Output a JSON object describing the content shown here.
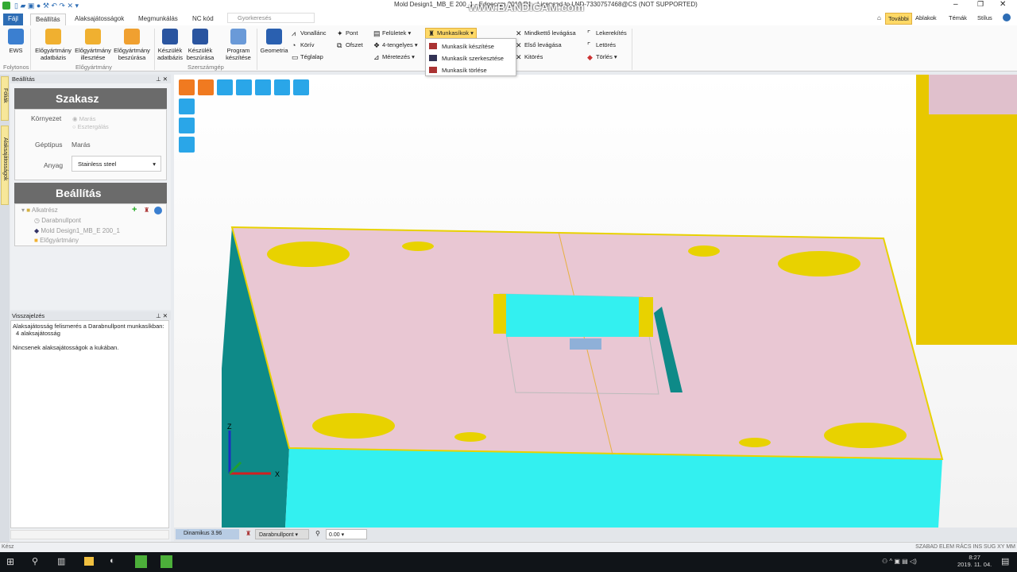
{
  "window": {
    "title": "Mold Design1_MB_E 200_1 - Edgecam 2019 R1 - Licensed to LND-7330757468@CS (NOT SUPPORTED)",
    "watermark": "www.BANDICAM.com"
  },
  "tabs": [
    {
      "label": "Fájl"
    },
    {
      "label": "Beállítás"
    },
    {
      "label": "Alaksajátosságok"
    },
    {
      "label": "Megmunkálás"
    },
    {
      "label": "NC kód"
    }
  ],
  "search_placeholder": "Gyorkeresés",
  "top_right": {
    "tovabbi": "További",
    "ablakok": "Ablakok",
    "temak": "Témák",
    "stilus": "Stílus"
  },
  "ribbon": {
    "ews": "EWS",
    "group_folytonos": "Folytonos",
    "elo_adatbazis": "Előgyártmány adatbázis",
    "elo_illesztese": "Előgyártmány illesztése",
    "elo_beszurasa": "Előgyártmány beszúrása",
    "group_elogyartmany": "Előgyártmány",
    "kesz_adatbazis": "Készülék adatbázis",
    "kesz_beszurasa": "Készülék beszúrása",
    "program": "Program készítése",
    "group_szerszamgep": "Szerszámgép",
    "geometria": "Geometria",
    "vonallanc": "Vonallánc",
    "koriv": "Körív",
    "teglalap": "Téglalap",
    "pont": "Pont",
    "ofszet": "Ofszet",
    "feluletek": "Felületek",
    "tengelyes": "4-tengelyes",
    "meretezes": "Méretezés",
    "munkasikok": "Munkasíkok",
    "mindketto": "Mindkettő levágása",
    "elso": "Első levágása",
    "kitores": "Kitörés",
    "lekerekites": "Lekerekítés",
    "letores": "Letörés",
    "torles": "Törlés"
  },
  "munkasik_menu": [
    "Munkasík készítése",
    "Munkasík szerkesztése",
    "Munkasík törlése"
  ],
  "left_tabs": [
    "Fóliák",
    "Alaksajátosságok"
  ],
  "panel": {
    "title": "Beállítás",
    "szakasz": "Szakasz",
    "kornyezet_label": "Környezet",
    "kornyezet_options": [
      "Marás",
      "Esztergálás"
    ],
    "geptipus_label": "Géptípus",
    "geptipus_value": "Marás",
    "anyag_label": "Anyag",
    "anyag_value": "Stainless steel",
    "beallitas": "Beállítás",
    "tree": {
      "root": "Alkatrész",
      "items": [
        "Darabnullpont",
        "Mold Design1_MB_E 200_1",
        "Előgyártmány"
      ]
    }
  },
  "feedback": {
    "title": "Visszajelzés",
    "lines": [
      "Alaksajátosság felismerés a Darabnullpont munkasíkban:",
      "4 alaksajátosság",
      "",
      "Nincsenek alaksajátosságok a kukában."
    ]
  },
  "viewbar": {
    "mode": "Dinamikus 3.96",
    "workplane": "Darabnullpont",
    "value": "0.00"
  },
  "axes": {
    "x": "X",
    "z": "Z"
  },
  "statusbar": {
    "left": "Kész",
    "right": "SZABAD ELEM RÁCS INS SUG XY MM"
  },
  "taskbar": {
    "time": "8:27",
    "date": "2019. 11. 04."
  },
  "colors": {
    "accent": "#2d6db5",
    "top_face": "#e9c7d3",
    "cyan": "#33f0f0",
    "teal": "#0e8a88",
    "yellow": "#e8d200",
    "highlight": "#ffd966"
  }
}
